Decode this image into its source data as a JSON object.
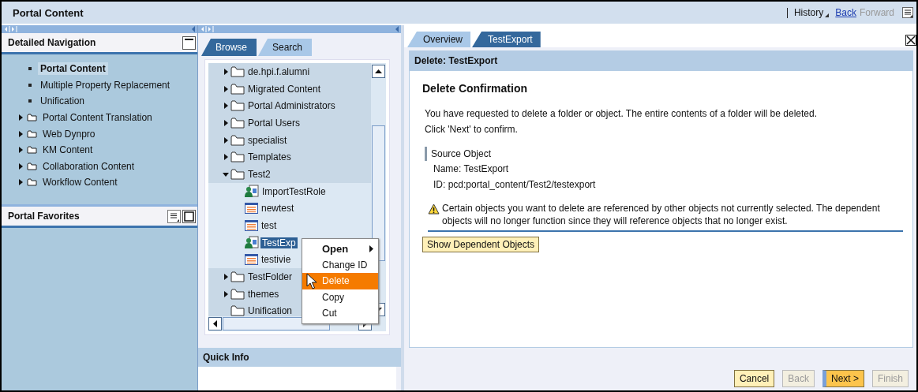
{
  "header": {
    "title": "Portal Content",
    "history": "History",
    "back": "Back",
    "forward": "Forward",
    "forward_disabled": true
  },
  "detailed_navigation": {
    "title": "Detailed Navigation",
    "items": [
      {
        "kind": "page",
        "label": "Portal Content",
        "selected": true
      },
      {
        "kind": "page",
        "label": "Multiple Property Replacement",
        "selected": false
      },
      {
        "kind": "page",
        "label": "Unification",
        "selected": false
      },
      {
        "kind": "folder",
        "label": "Portal Content Translation",
        "selected": false
      },
      {
        "kind": "folder",
        "label": "Web Dynpro",
        "selected": false
      },
      {
        "kind": "folder",
        "label": "KM Content",
        "selected": false
      },
      {
        "kind": "folder",
        "label": "Collaboration Content",
        "selected": false
      },
      {
        "kind": "folder",
        "label": "Workflow Content",
        "selected": false
      }
    ]
  },
  "portal_favorites": {
    "title": "Portal Favorites"
  },
  "browser": {
    "tabs": [
      {
        "label": "Browse",
        "selected": true
      },
      {
        "label": "Search",
        "selected": false
      }
    ],
    "tree": [
      {
        "kind": "folder",
        "label": "de.hpi.f.alumni",
        "expanded": false,
        "selected": false
      },
      {
        "kind": "folder",
        "label": "Migrated Content",
        "expanded": false,
        "selected": false
      },
      {
        "kind": "folder",
        "label": "Portal Administrators",
        "expanded": false,
        "selected": false
      },
      {
        "kind": "folder",
        "label": "Portal Users",
        "expanded": false,
        "selected": false
      },
      {
        "kind": "folder",
        "label": "specialist",
        "expanded": false,
        "selected": false
      },
      {
        "kind": "folder",
        "label": "Templates",
        "expanded": false,
        "selected": false
      },
      {
        "kind": "folder",
        "label": "Test2",
        "expanded": true,
        "selected": false,
        "children": [
          {
            "kind": "role",
            "label": "ImportTestRole",
            "selected": false
          },
          {
            "kind": "iview",
            "label": "newtest",
            "selected": false
          },
          {
            "kind": "iview",
            "label": "test",
            "selected": false
          },
          {
            "kind": "role",
            "label": "TestExp",
            "selected": true
          },
          {
            "kind": "iview",
            "label": "testivie",
            "selected": false
          }
        ]
      },
      {
        "kind": "folder",
        "label": "TestFolder",
        "expanded": false,
        "selected": false
      },
      {
        "kind": "folder",
        "label": "themes",
        "expanded": false,
        "selected": false
      },
      {
        "kind": "folder",
        "label": "Unification",
        "selected": false
      }
    ],
    "context_menu": [
      {
        "label": "Open",
        "submenu": true,
        "selected": false
      },
      {
        "label": "Change ID",
        "submenu": false,
        "selected": false
      },
      {
        "label": "Delete",
        "submenu": false,
        "selected": true
      },
      {
        "label": "Copy",
        "submenu": false,
        "selected": false
      },
      {
        "label": "Cut",
        "submenu": false,
        "selected": false
      }
    ],
    "quick_info": {
      "title": "Quick Info"
    }
  },
  "editor": {
    "tabs": [
      {
        "label": "Overview",
        "selected": false
      },
      {
        "label": "TestExport",
        "selected": true
      }
    ],
    "title": "Delete: TestExport",
    "heading": "Delete Confirmation",
    "intro": [
      "You have requested to delete a folder or object. The entire contents of a folder will be deleted.",
      "Click 'Next' to confirm."
    ],
    "source_object": {
      "label": "Source Object",
      "lines": [
        "Name: TestExport",
        "ID: pcd:portal_content/Test2/testexport"
      ]
    },
    "warning": "Certain objects you want to delete are referenced by other objects not currently selected. The dependent objects will no longer function since they will reference objects that no longer exist.",
    "dependents_button": "Show Dependent Objects",
    "buttons": [
      {
        "label": "Cancel",
        "disabled": false,
        "primary": false
      },
      {
        "label": "Back",
        "disabled": true,
        "primary": false
      },
      {
        "label": "Next >",
        "disabled": false,
        "primary": true
      },
      {
        "label": "Finish",
        "disabled": true,
        "primary": false
      }
    ]
  }
}
